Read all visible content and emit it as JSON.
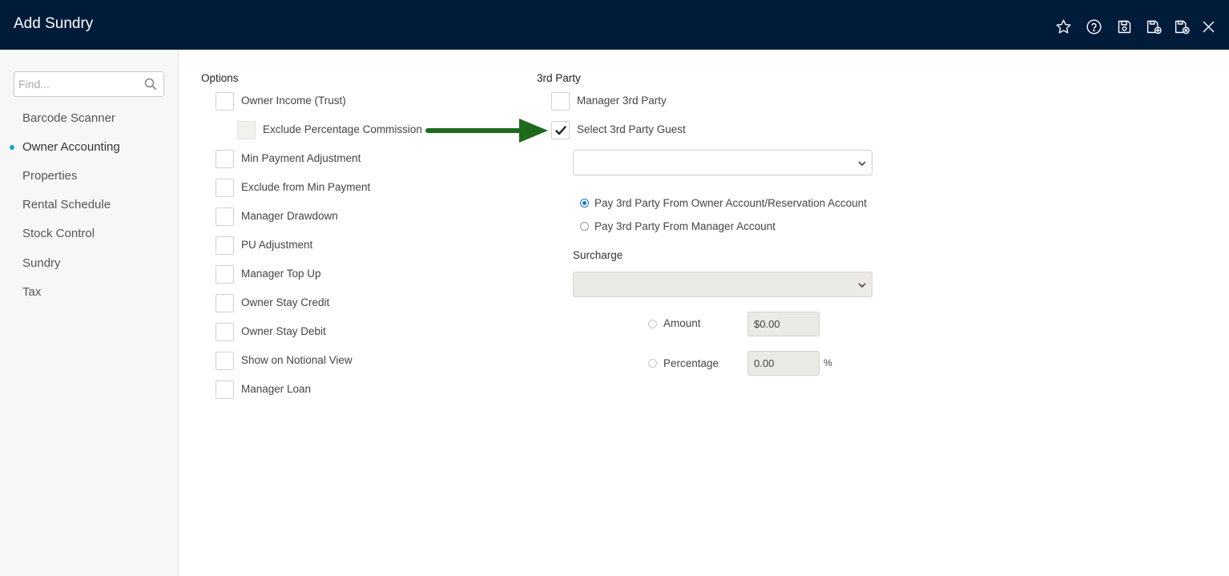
{
  "header": {
    "title": "Add Sundry",
    "icons": [
      "star-icon",
      "help-icon",
      "save-icon",
      "save-and-new-icon",
      "save-and-close-icon",
      "close-icon"
    ]
  },
  "sidebar": {
    "search_placeholder": "Find...",
    "items": [
      {
        "label": "Barcode Scanner",
        "active": false
      },
      {
        "label": "Owner Accounting",
        "active": true
      },
      {
        "label": "Properties",
        "active": false
      },
      {
        "label": "Rental Schedule",
        "active": false
      },
      {
        "label": "Stock Control",
        "active": false
      },
      {
        "label": "Sundry",
        "active": false
      },
      {
        "label": "Tax",
        "active": false
      }
    ]
  },
  "options": {
    "heading": "Options",
    "items": [
      {
        "label": "Owner Income (Trust)",
        "checked": false
      },
      {
        "label": "Exclude Percentage Commission",
        "checked": false,
        "disabled": true
      },
      {
        "label": "Min Payment Adjustment",
        "checked": false
      },
      {
        "label": "Exclude from Min Payment",
        "checked": false
      },
      {
        "label": "Manager Drawdown",
        "checked": false
      },
      {
        "label": "PU Adjustment",
        "checked": false
      },
      {
        "label": "Manager Top Up",
        "checked": false
      },
      {
        "label": "Owner Stay Credit",
        "checked": false
      },
      {
        "label": "Owner Stay Debit",
        "checked": false
      },
      {
        "label": "Show on Notional View",
        "checked": false
      },
      {
        "label": "Manager Loan",
        "checked": false
      }
    ]
  },
  "third_party": {
    "heading": "3rd Party",
    "manager_label": "Manager 3rd Party",
    "manager_checked": false,
    "guest_label": "Select 3rd Party Guest",
    "guest_checked": true,
    "guest_select_value": "",
    "pay_options": [
      {
        "label": "Pay 3rd Party From Owner Account/Reservation Account",
        "selected": true
      },
      {
        "label": "Pay 3rd Party From Manager Account",
        "selected": false
      }
    ],
    "surcharge_label": "Surcharge",
    "surcharge_value": "",
    "amount_label": "Amount",
    "amount_value": "$0.00",
    "percentage_label": "Percentage",
    "percentage_value": "0.00",
    "percent_symbol": "%"
  },
  "colors": {
    "header_bg": "#011b3a",
    "accent": "#1aa1d8",
    "arrow": "#1e6b1e"
  }
}
